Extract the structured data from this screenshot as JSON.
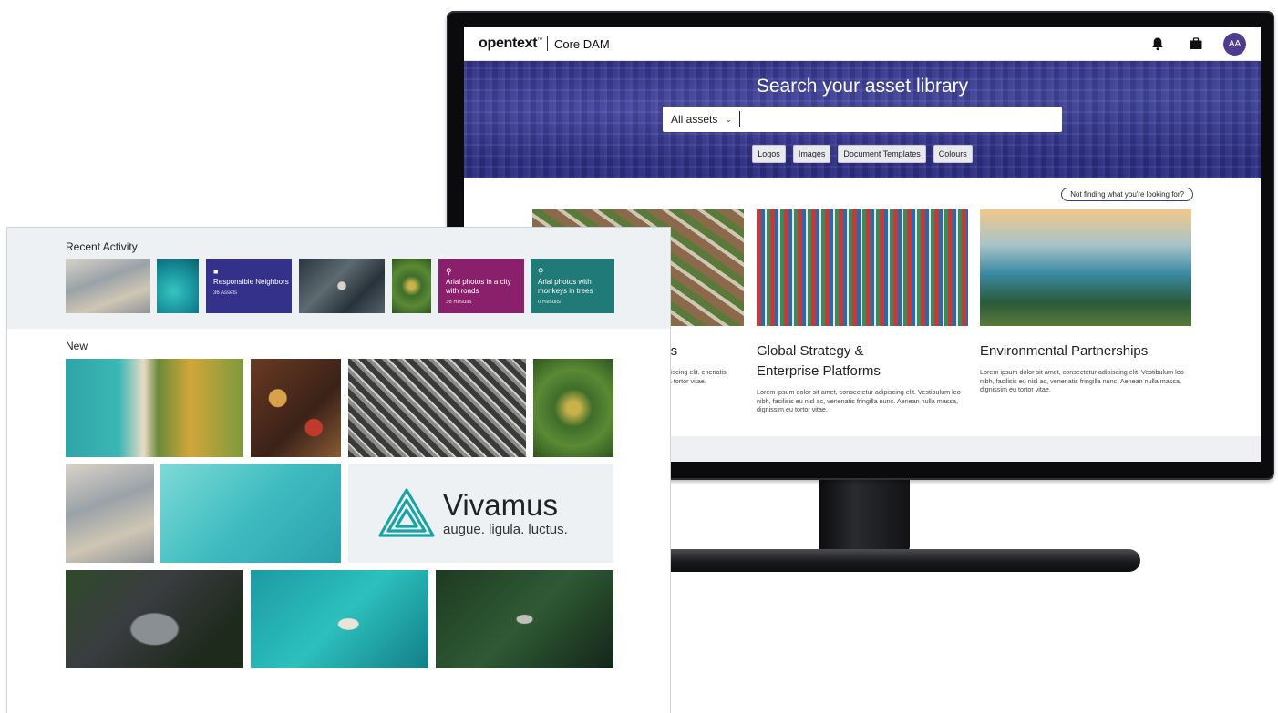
{
  "core_dam": {
    "brand": {
      "logo_text": "opentext",
      "trademark": "™",
      "product": "Core DAM"
    },
    "header_icons": [
      "bell-icon",
      "briefcase-icon"
    ],
    "user": {
      "initials": "AA",
      "avatar_color": "#4e3c8e"
    },
    "hero": {
      "title": "Search your asset library",
      "scope_value": "All assets",
      "search_value": "",
      "quick_filters": [
        "Logos",
        "Images",
        "Document Templates",
        "Colours"
      ]
    },
    "help_link": "Not finding what you're looking for?",
    "cards": [
      {
        "title_line1": "bors",
        "title_line2": "",
        "body": "ur adipiscing elit. enenatis fringilla tortor vitae."
      },
      {
        "title_line1": "Global Strategy &",
        "title_line2": "Enterprise Platforms",
        "body": "Lorem ipsum dolor sit amet, consectetur adipiscing elit. Vestibulum leo nibh, facilisis eu nisl ac, venenatis fringilla nunc. Aenean nulla massa, dignissim eu tortor vitae."
      },
      {
        "title_line1": "Environmental Partnerships",
        "title_line2": "",
        "body": "Lorem ipsum dolor sit amet, consectetur adipiscing elit. Vestibulum leo nibh, facilisis eu nisl ac, venenatis fringilla nunc. Aenean nulla massa, dignissim eu tortor vitae."
      }
    ]
  },
  "front_panel": {
    "recent_label": "Recent Activity",
    "recent_tiles": [
      {
        "title": "Responsible Neighbors",
        "subtitle": "36 Assets",
        "icon": "folder-icon",
        "color": "#34318a"
      },
      {
        "title": "Arial photos in a city with roads",
        "subtitle": "36 Results",
        "icon": "search-icon",
        "color": "#8a1f6b"
      },
      {
        "title": "Arial photos with monkeys in trees",
        "subtitle": "0 Results",
        "icon": "search-icon",
        "color": "#1f7a78"
      }
    ],
    "new_label": "New",
    "brand_tile": {
      "title": "Vivamus",
      "subtitle": "augue. ligula. luctus.",
      "color": "#1aa3a7"
    }
  }
}
